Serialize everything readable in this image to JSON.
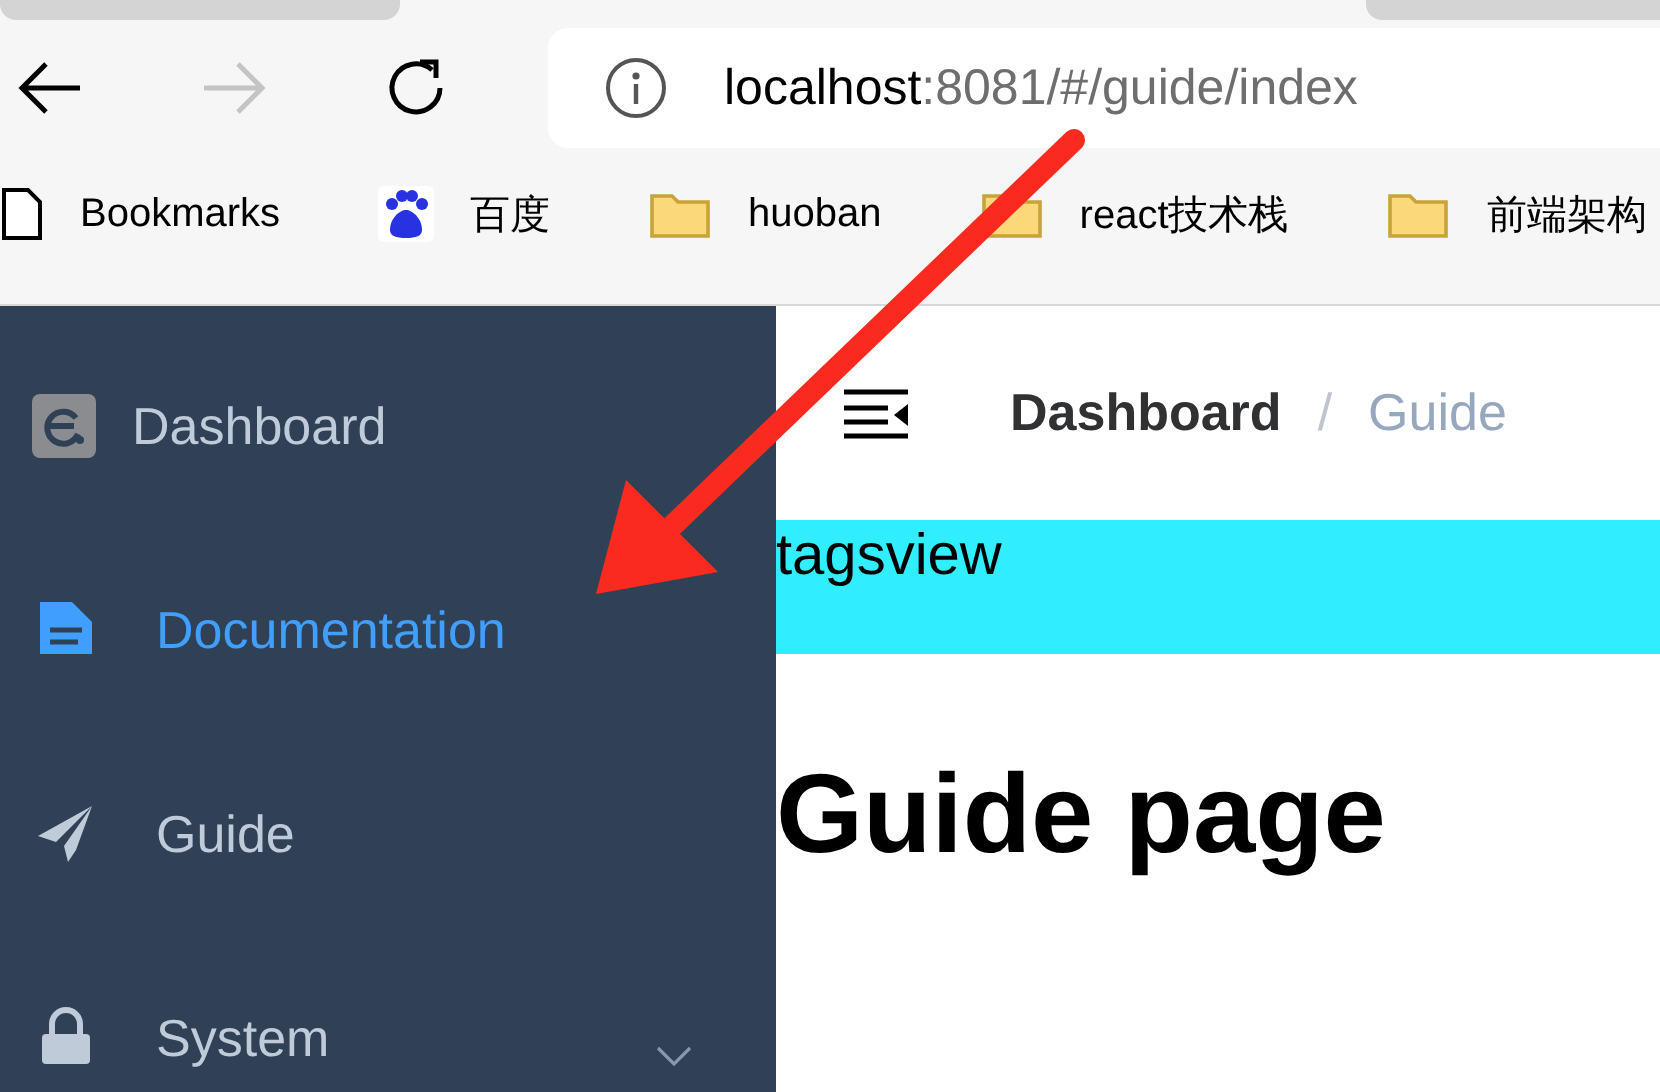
{
  "browser": {
    "url_host": "localhost",
    "url_path": ":8081/#/guide/index",
    "bookmarks": [
      {
        "label": "Bookmarks",
        "kind": "page"
      },
      {
        "label": "百度",
        "kind": "baidu"
      },
      {
        "label": "huoban",
        "kind": "folder"
      },
      {
        "label": "react技术栈",
        "kind": "folder"
      },
      {
        "label": "前端架构",
        "kind": "folder"
      }
    ]
  },
  "sidebar": {
    "items": [
      {
        "label": "Dashboard",
        "kind": "dashboard",
        "selected": false
      },
      {
        "label": "Documentation",
        "kind": "document",
        "selected": true
      },
      {
        "label": "Guide",
        "kind": "plane",
        "selected": false
      },
      {
        "label": "System",
        "kind": "lock",
        "selected": false,
        "expanded": false
      }
    ]
  },
  "breadcrumb": [
    {
      "label": "Dashboard",
      "current": false
    },
    {
      "label": "Guide",
      "current": true
    }
  ],
  "breadcrumb_separator": "/",
  "tagsview": "tagsview",
  "heading": "Guide page"
}
